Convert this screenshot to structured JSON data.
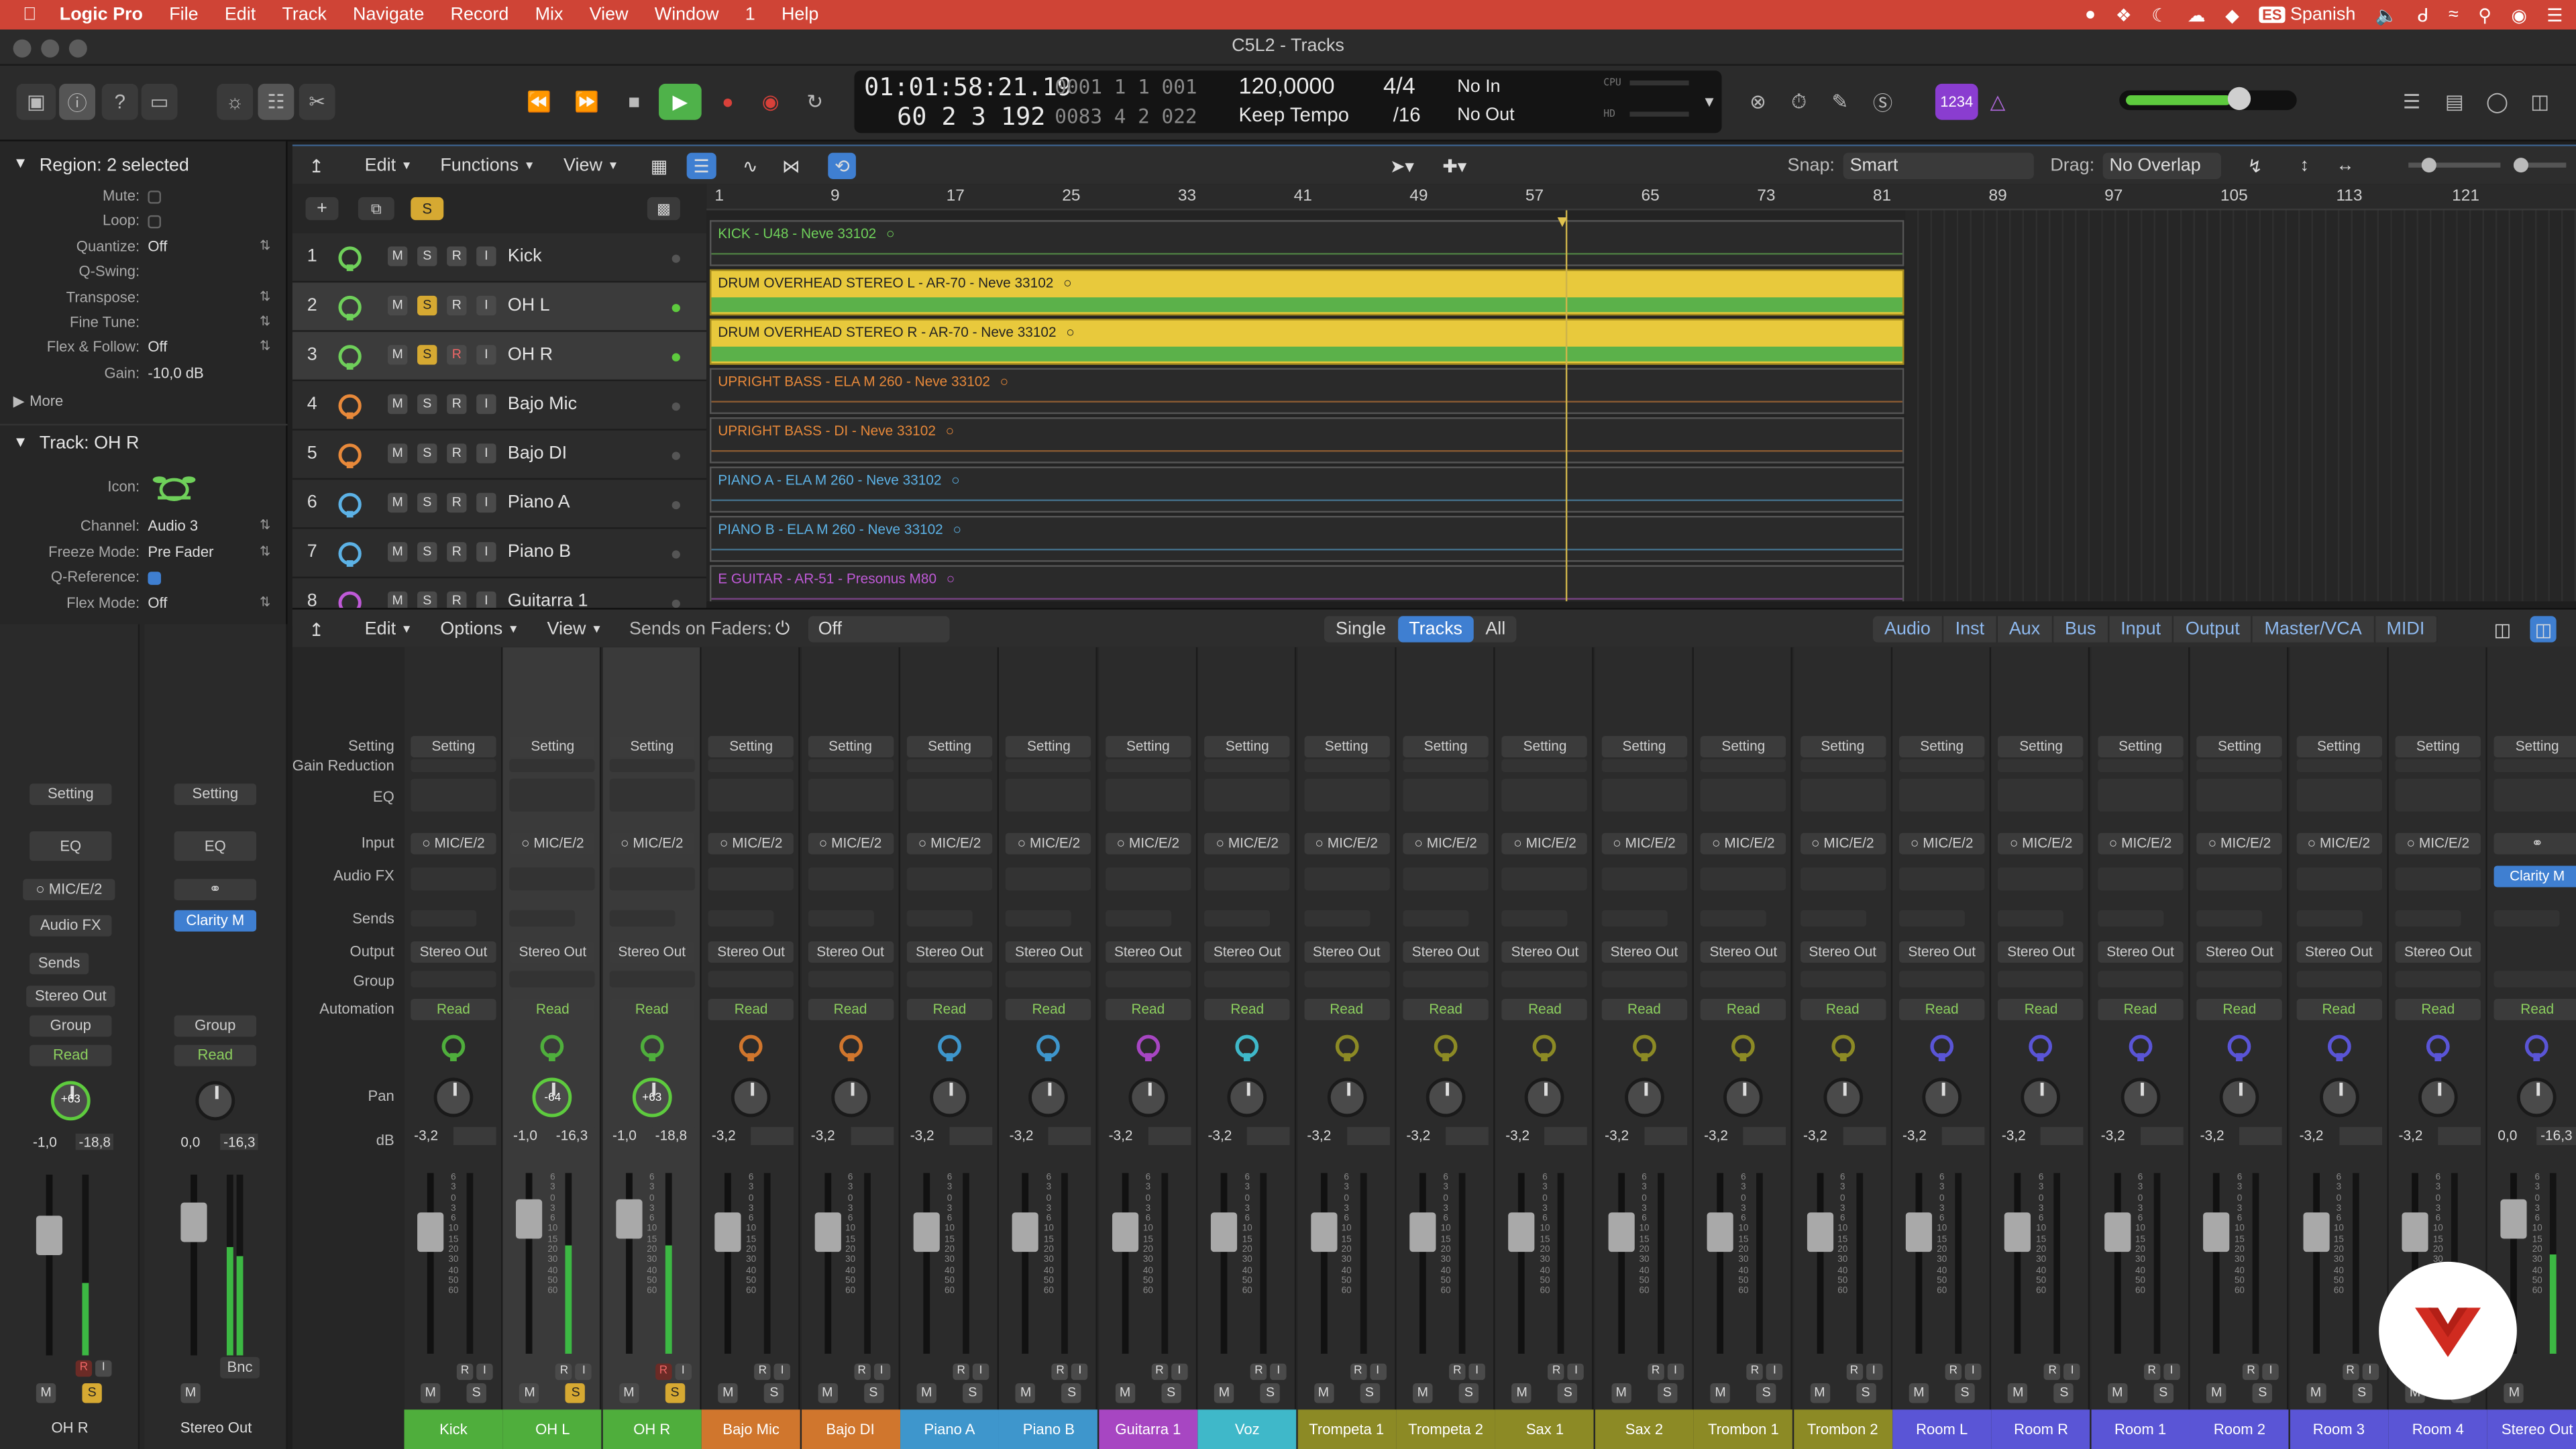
{
  "menubar": {
    "apple": "",
    "items": [
      "Logic Pro",
      "File",
      "Edit",
      "Track",
      "Navigate",
      "Record",
      "Mix",
      "View",
      "Window",
      "1",
      "Help"
    ],
    "input_source": "Spanish"
  },
  "window": {
    "title": "C5L2 - Tracks"
  },
  "lcd": {
    "position_time": "01:01:58:21.19",
    "position_bars": "60  2  3  192",
    "end_a": "0001  1  1  001",
    "end_b": "0083  4  2  022",
    "tempo": "120,0000",
    "tempo_mode": "Keep Tempo",
    "sig_top": "4/4",
    "sig_bottom": "/16",
    "in": "No In",
    "out": "No Out",
    "cpu": "CPU",
    "hd": "HD"
  },
  "control": {
    "badge": "1234"
  },
  "inspector": {
    "region_header": "Region: 2 selected",
    "rows": [
      {
        "label": "Mute:",
        "value": ""
      },
      {
        "label": "Loop:",
        "value": ""
      },
      {
        "label": "Quantize:",
        "value": "Off"
      },
      {
        "label": "Q-Swing:",
        "value": ""
      },
      {
        "label": "Transpose:",
        "value": ""
      },
      {
        "label": "Fine Tune:",
        "value": ""
      },
      {
        "label": "Flex & Follow:",
        "value": "Off"
      },
      {
        "label": "Gain:",
        "value": "-10,0 dB"
      }
    ],
    "more": "More",
    "track_header": "Track:  OH R",
    "track_rows": [
      {
        "label": "Icon:",
        "value": ""
      },
      {
        "label": "Channel:",
        "value": "Audio 3"
      },
      {
        "label": "Freeze Mode:",
        "value": "Pre Fader"
      },
      {
        "label": "Q-Reference:",
        "value": ""
      },
      {
        "label": "Flex Mode:",
        "value": "Off"
      }
    ],
    "strip_a": {
      "setting": "Setting",
      "eq": "EQ",
      "input": "MIC/E/2",
      "audiofx": "Audio FX",
      "sends": "Sends",
      "output": "Stereo Out",
      "group": "Group",
      "read": "Read",
      "pan": "+63",
      "db1": "-1,0",
      "db2": "-18,8",
      "m": "M",
      "s": "S",
      "r": "R",
      "i": "I",
      "name": "OH R"
    },
    "strip_b": {
      "setting": "Setting",
      "eq": "EQ",
      "plugin": "Clarity M",
      "group": "Group",
      "read": "Read",
      "db1": "0,0",
      "db2": "-16,3",
      "m": "M",
      "bnc": "Bnc",
      "name": "Stereo Out"
    }
  },
  "tracks_toolbar": {
    "edit": "Edit",
    "functions": "Functions",
    "view": "View",
    "snap_label": "Snap:",
    "snap": "Smart",
    "drag_label": "Drag:",
    "drag": "No Overlap",
    "s": "S"
  },
  "ruler": [
    "1",
    "9",
    "17",
    "25",
    "33",
    "41",
    "49",
    "57",
    "65",
    "73",
    "81",
    "89",
    "97",
    "105",
    "113",
    "121"
  ],
  "tracks": [
    {
      "num": "1",
      "name": "Kick",
      "region": "KICK - U48 - Neve 33102",
      "color": "#6fd05a"
    },
    {
      "num": "2",
      "name": "OH L",
      "region": "DRUM OVERHEAD STEREO L - AR-70 - Neve 33102",
      "color": "#6fd05a"
    },
    {
      "num": "3",
      "name": "OH R",
      "region": "DRUM OVERHEAD STEREO R - AR-70 - Neve 33102",
      "color": "#6fd05a"
    },
    {
      "num": "4",
      "name": "Bajo Mic",
      "region": "UPRIGHT BASS - ELA M 260 - Neve 33102",
      "color": "#e8893a"
    },
    {
      "num": "5",
      "name": "Bajo DI",
      "region": "UPRIGHT BASS - DI - Neve 33102",
      "color": "#e8893a"
    },
    {
      "num": "6",
      "name": "Piano A",
      "region": "PIANO A - ELA M 260 - Neve 33102",
      "color": "#5cb2e6"
    },
    {
      "num": "7",
      "name": "Piano B",
      "region": "PIANO B - ELA M 260 - Neve 33102",
      "color": "#5cb2e6"
    },
    {
      "num": "8",
      "name": "Guitarra 1",
      "region": "E GUITAR - AR-51 - Presonus M80",
      "color": "#c05ad8"
    }
  ],
  "mixer_toolbar": {
    "edit": "Edit",
    "options": "Options",
    "view": "View",
    "sends_label": "Sends on Faders:",
    "sends_value": "Off",
    "views": [
      "Single",
      "Tracks",
      "All"
    ],
    "filters": [
      "Audio",
      "Inst",
      "Aux",
      "Bus",
      "Input",
      "Output",
      "Master/VCA",
      "MIDI"
    ]
  },
  "mixer_labels": [
    "Setting",
    "Gain Reduction",
    "EQ",
    "Input",
    "Audio FX",
    "Sends",
    "Output",
    "Group",
    "Automation",
    "Pan",
    "dB"
  ],
  "mixer_common": {
    "setting": "Setting",
    "input": "MIC/E/2",
    "output": "Stereo Out",
    "read": "Read",
    "m": "M",
    "s": "S",
    "r": "R",
    "i": "I"
  },
  "strips": [
    {
      "name": "Kick",
      "pan": "",
      "db": "-3,2",
      "db2": "",
      "color": "#4fae3c",
      "sel": false
    },
    {
      "name": "OH L",
      "pan": "-64",
      "db": "-1,0",
      "db2": "-16,3",
      "color": "#4fae3c",
      "sel": true
    },
    {
      "name": "OH R",
      "pan": "+63",
      "db": "-1,0",
      "db2": "-18,8",
      "color": "#4fae3c",
      "sel": true
    },
    {
      "name": "Bajo Mic",
      "pan": "",
      "db": "-3,2",
      "db2": "",
      "color": "#d0762d",
      "sel": false
    },
    {
      "name": "Bajo DI",
      "pan": "",
      "db": "-3,2",
      "db2": "",
      "color": "#d0762d",
      "sel": false
    },
    {
      "name": "Piano A",
      "pan": "",
      "db": "-3,2",
      "db2": "",
      "color": "#3e96cc",
      "sel": false
    },
    {
      "name": "Piano B",
      "pan": "",
      "db": "-3,2",
      "db2": "",
      "color": "#3e96cc",
      "sel": false
    },
    {
      "name": "Guitarra 1",
      "pan": "",
      "db": "-3,2",
      "db2": "",
      "color": "#a746c2",
      "sel": false
    },
    {
      "name": "Voz",
      "pan": "",
      "db": "-3,2",
      "db2": "",
      "color": "#3fb8c9",
      "sel": false
    },
    {
      "name": "Trompeta 1",
      "pan": "",
      "db": "-3,2",
      "db2": "",
      "color": "#8c8a25",
      "sel": false
    },
    {
      "name": "Trompeta 2",
      "pan": "",
      "db": "-3,2",
      "db2": "",
      "color": "#8c8a25",
      "sel": false
    },
    {
      "name": "Sax 1",
      "pan": "",
      "db": "-3,2",
      "db2": "",
      "color": "#8c8a25",
      "sel": false
    },
    {
      "name": "Sax 2",
      "pan": "",
      "db": "-3,2",
      "db2": "",
      "color": "#8c8a25",
      "sel": false
    },
    {
      "name": "Trombon 1",
      "pan": "",
      "db": "-3,2",
      "db2": "",
      "color": "#8c8a25",
      "sel": false
    },
    {
      "name": "Trombon 2",
      "pan": "",
      "db": "-3,2",
      "db2": "",
      "color": "#8c8a25",
      "sel": false
    },
    {
      "name": "Room L",
      "pan": "",
      "db": "-3,2",
      "db2": "",
      "color": "#5a55d6",
      "sel": false
    },
    {
      "name": "Room R",
      "pan": "",
      "db": "-3,2",
      "db2": "",
      "color": "#5a55d6",
      "sel": false
    },
    {
      "name": "Room 1",
      "pan": "",
      "db": "-3,2",
      "db2": "",
      "color": "#5a55d6",
      "sel": false
    },
    {
      "name": "Room 2",
      "pan": "",
      "db": "-3,2",
      "db2": "",
      "color": "#5a55d6",
      "sel": false
    },
    {
      "name": "Room 3",
      "pan": "",
      "db": "-3,2",
      "db2": "",
      "color": "#5a55d6",
      "sel": false
    },
    {
      "name": "Room 4",
      "pan": "",
      "db": "-3,2",
      "db2": "",
      "color": "#5a55d6",
      "sel": false
    },
    {
      "name": "Stereo Out",
      "pan": "",
      "db": "0,0",
      "db2": "-16,3",
      "color": "#5a55d6",
      "sel": false
    }
  ],
  "last_strip_plugin": "Clarity M",
  "fader_scale": [
    "6",
    "3",
    "0",
    "3",
    "6",
    "10",
    "15",
    "20",
    "30",
    "40",
    "50",
    "60"
  ],
  "colors": {
    "menubar": "#cf4436",
    "accent": "#3f7fd1",
    "play": "#4fb24a",
    "record": "#d8413a"
  }
}
